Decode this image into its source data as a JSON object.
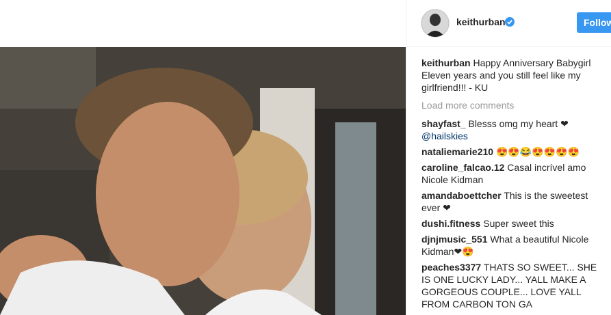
{
  "post": {
    "username": "keithurban",
    "follow_label": "Follow",
    "verified_icon": "verified-badge-icon",
    "accent_color": "#3897f0"
  },
  "caption": {
    "username": "keithurban",
    "text": "Happy Anniversary Babygirl Eleven years and you still feel like my girlfriend!!! - KU"
  },
  "load_more_label": "Load more comments",
  "comments": [
    {
      "username": "shayfast_",
      "text": "Blesss omg my heart ❤",
      "mention": "@hailskies"
    },
    {
      "username": "nataliemarie210",
      "text": "😍😍😂😍😍😍😍"
    },
    {
      "username": "caroline_falcao.12",
      "text": "Casal incrível amo Nicole Kidman"
    },
    {
      "username": "amandaboettcher",
      "text": "This is the sweetest ever ❤"
    },
    {
      "username": "dushi.fitness",
      "text": "Super sweet this"
    },
    {
      "username": "djnjmusic_551",
      "text": "What a beautiful Nicole Kidman❤😍"
    },
    {
      "username": "peaches3377",
      "text": "THATS SO SWEET... SHE IS ONE LUCKY LADY... YALL MAKE A GORGEOUS COUPLE... LOVE YALL FROM CARBON TON GA"
    }
  ]
}
